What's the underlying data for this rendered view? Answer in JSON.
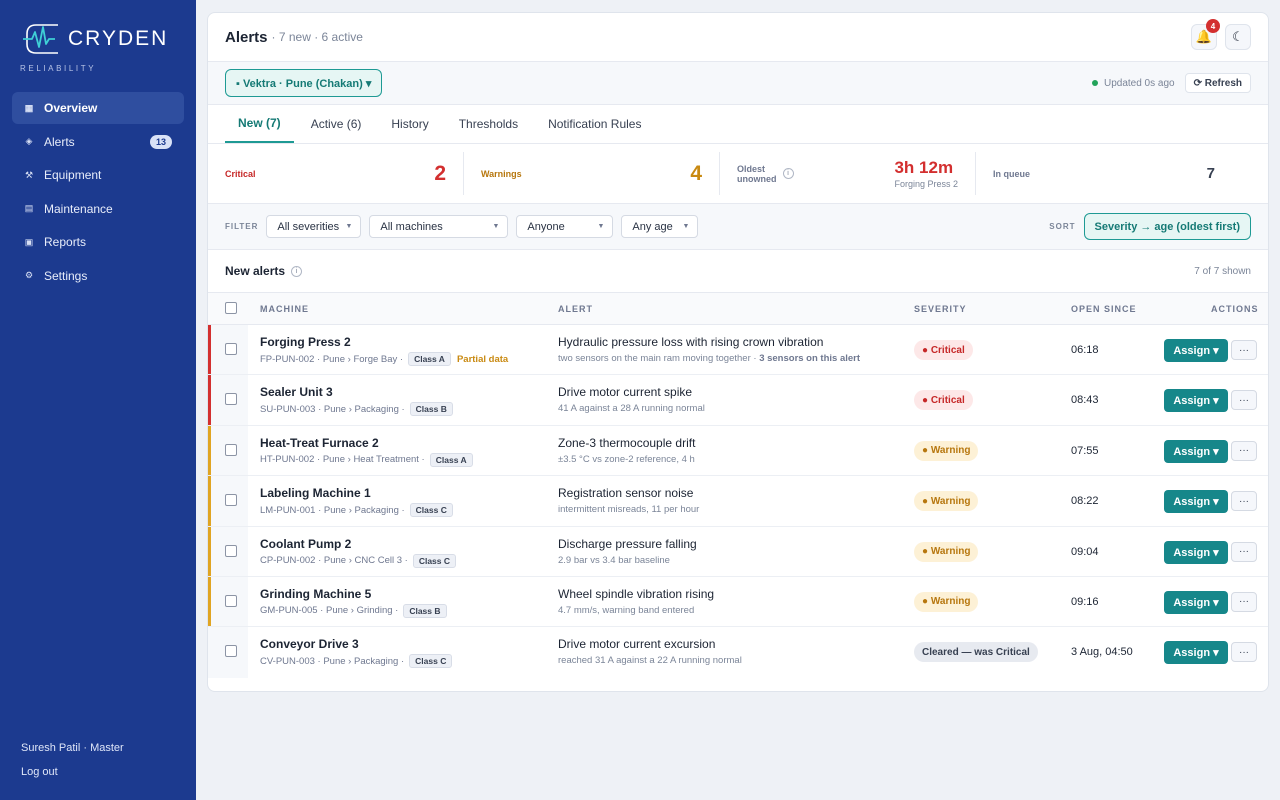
{
  "brand": {
    "name": "CRYDEN",
    "tagline": "RELIABILITY"
  },
  "nav": [
    {
      "label": "Overview",
      "icon": "grid-icon",
      "glyph": "▦",
      "active": true,
      "badge": ""
    },
    {
      "label": "Alerts",
      "icon": "diamond-icon",
      "glyph": "◈",
      "active": false,
      "badge": "13"
    },
    {
      "label": "Equipment",
      "icon": "tools-icon",
      "glyph": "⚒",
      "active": false,
      "badge": ""
    },
    {
      "label": "Maintenance",
      "icon": "calendar-icon",
      "glyph": "▤",
      "active": false,
      "badge": ""
    },
    {
      "label": "Reports",
      "icon": "report-icon",
      "glyph": "▣",
      "active": false,
      "badge": ""
    },
    {
      "label": "Settings",
      "icon": "gear-icon",
      "glyph": "⚙",
      "active": false,
      "badge": ""
    }
  ],
  "user": {
    "name": "Suresh Patil · Master",
    "logout": "Log out"
  },
  "header": {
    "title": "Alerts",
    "subtitle": "· 7 new · 6 active",
    "bell_count": "4",
    "bell_glyph": "🔔",
    "theme_glyph": "☾"
  },
  "site": {
    "label": "▪ Vektra · Pune (Chakan) ▾",
    "updated": "Updated 0s ago",
    "refresh": "⟳ Refresh"
  },
  "tabs": [
    {
      "label": "New (7)",
      "active": true
    },
    {
      "label": "Active (6)",
      "active": false
    },
    {
      "label": "History",
      "active": false
    },
    {
      "label": "Thresholds",
      "active": false
    },
    {
      "label": "Notification Rules",
      "active": false
    }
  ],
  "stats": {
    "critical_label": "Critical",
    "critical_value": "2",
    "warnings_label": "Warnings",
    "warnings_value": "4",
    "oldest_label_1": "Oldest",
    "oldest_label_2": "unowned",
    "oldest_value": "3h 12m",
    "oldest_machine": "Forging Press 2",
    "queue_label": "In queue",
    "queue_value": "7"
  },
  "filters": {
    "label": "FILTER",
    "severity": "All severities",
    "machines": "All machines",
    "owner": "Anyone",
    "age": "Any age",
    "sort_label": "SORT",
    "sort_value": "Severity → age (oldest first)"
  },
  "list": {
    "title": "New alerts",
    "shown": "7 of 7 shown",
    "columns": {
      "machine": "MACHINE",
      "alert": "ALERT",
      "severity": "SEVERITY",
      "open_since": "OPEN SINCE",
      "actions": "ACTIONS"
    },
    "assign_label": "Assign ▾",
    "more_label": "···"
  },
  "colors": {
    "critical": "#d32f2f",
    "warning": "#e0a422",
    "accent": "#1e9a94",
    "sidebar": "#1c3a8f"
  },
  "rows": [
    {
      "machine": "Forging Press 2",
      "meta": "FP-PUN-002 · Pune › Forge Bay ·",
      "class": "Class A",
      "partial": "Partial data",
      "alert": "Hydraulic pressure loss with rising crown vibration",
      "detail": "two sensors on the main ram moving together ·",
      "detail_bold": "3 sensors on this alert",
      "severity": "critical",
      "severity_label": "● Critical",
      "open": "06:18"
    },
    {
      "machine": "Sealer Unit 3",
      "meta": "SU-PUN-003 · Pune › Packaging ·",
      "class": "Class B",
      "partial": "",
      "alert": "Drive motor current spike",
      "detail": "41 A against a 28 A running normal",
      "detail_bold": "",
      "severity": "critical",
      "severity_label": "● Critical",
      "open": "08:43"
    },
    {
      "machine": "Heat-Treat Furnace 2",
      "meta": "HT-PUN-002 · Pune › Heat Treatment ·",
      "class": "Class A",
      "partial": "",
      "alert": "Zone-3 thermocouple drift",
      "detail": "±3.5 °C vs zone-2 reference, 4 h",
      "detail_bold": "",
      "severity": "warning",
      "severity_label": "● Warning",
      "open": "07:55"
    },
    {
      "machine": "Labeling Machine 1",
      "meta": "LM-PUN-001 · Pune › Packaging ·",
      "class": "Class C",
      "partial": "",
      "alert": "Registration sensor noise",
      "detail": "intermittent misreads, 11 per hour",
      "detail_bold": "",
      "severity": "warning",
      "severity_label": "● Warning",
      "open": "08:22"
    },
    {
      "machine": "Coolant Pump 2",
      "meta": "CP-PUN-002 · Pune › CNC Cell 3 ·",
      "class": "Class C",
      "partial": "",
      "alert": "Discharge pressure falling",
      "detail": "2.9 bar vs 3.4 bar baseline",
      "detail_bold": "",
      "severity": "warning",
      "severity_label": "● Warning",
      "open": "09:04"
    },
    {
      "machine": "Grinding Machine 5",
      "meta": "GM-PUN-005 · Pune › Grinding ·",
      "class": "Class B",
      "partial": "",
      "alert": "Wheel spindle vibration rising",
      "detail": "4.7 mm/s, warning band entered",
      "detail_bold": "",
      "severity": "warning",
      "severity_label": "● Warning",
      "open": "09:16"
    },
    {
      "machine": "Conveyor Drive 3",
      "meta": "CV-PUN-003 · Pune › Packaging ·",
      "class": "Class C",
      "partial": "",
      "alert": "Drive motor current excursion",
      "detail": "reached 31 A against a 22 A running normal",
      "detail_bold": "",
      "severity": "cleared",
      "severity_label": "Cleared — was Critical",
      "open": "3 Aug, 04:50"
    }
  ]
}
